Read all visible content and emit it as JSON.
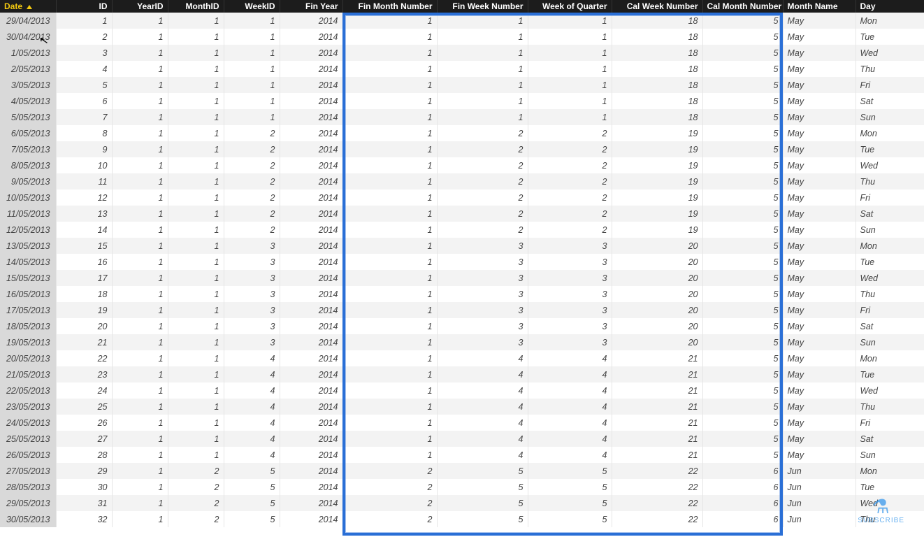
{
  "columns": [
    {
      "key": "date",
      "label": "Date",
      "align": "left",
      "sort": true,
      "colclass": "c-date"
    },
    {
      "key": "id",
      "label": "ID",
      "align": "right",
      "colclass": "c-id"
    },
    {
      "key": "year_id",
      "label": "YearID",
      "align": "right",
      "colclass": "c-yearid"
    },
    {
      "key": "month_id",
      "label": "MonthID",
      "align": "right",
      "colclass": "c-monthid"
    },
    {
      "key": "week_id",
      "label": "WeekID",
      "align": "right",
      "colclass": "c-weekid"
    },
    {
      "key": "fin_year",
      "label": "Fin Year",
      "align": "right",
      "colclass": "c-finyr"
    },
    {
      "key": "fin_month_number",
      "label": "Fin Month Number",
      "align": "right",
      "colclass": "c-finmon"
    },
    {
      "key": "fin_week_number",
      "label": "Fin Week Number",
      "align": "right",
      "colclass": "c-finwk"
    },
    {
      "key": "week_of_quarter",
      "label": "Week of Quarter",
      "align": "right",
      "colclass": "c-woq"
    },
    {
      "key": "cal_week_number",
      "label": "Cal Week Number",
      "align": "right",
      "colclass": "c-calwk"
    },
    {
      "key": "cal_month_number",
      "label": "Cal Month Number",
      "align": "right",
      "colclass": "c-calmon"
    },
    {
      "key": "month_name",
      "label": "Month Name",
      "align": "left",
      "colclass": "c-mname"
    },
    {
      "key": "day",
      "label": "Day",
      "align": "left",
      "colclass": "c-day"
    }
  ],
  "rows": [
    {
      "date": "29/04/2013",
      "id": "1",
      "year_id": "1",
      "month_id": "1",
      "week_id": "1",
      "fin_year": "2014",
      "fin_month_number": "1",
      "fin_week_number": "1",
      "week_of_quarter": "1",
      "cal_week_number": "18",
      "cal_month_number": "5",
      "month_name": "May",
      "day": "Mon"
    },
    {
      "date": "30/04/2013",
      "id": "2",
      "year_id": "1",
      "month_id": "1",
      "week_id": "1",
      "fin_year": "2014",
      "fin_month_number": "1",
      "fin_week_number": "1",
      "week_of_quarter": "1",
      "cal_week_number": "18",
      "cal_month_number": "5",
      "month_name": "May",
      "day": "Tue"
    },
    {
      "date": "1/05/2013",
      "id": "3",
      "year_id": "1",
      "month_id": "1",
      "week_id": "1",
      "fin_year": "2014",
      "fin_month_number": "1",
      "fin_week_number": "1",
      "week_of_quarter": "1",
      "cal_week_number": "18",
      "cal_month_number": "5",
      "month_name": "May",
      "day": "Wed"
    },
    {
      "date": "2/05/2013",
      "id": "4",
      "year_id": "1",
      "month_id": "1",
      "week_id": "1",
      "fin_year": "2014",
      "fin_month_number": "1",
      "fin_week_number": "1",
      "week_of_quarter": "1",
      "cal_week_number": "18",
      "cal_month_number": "5",
      "month_name": "May",
      "day": "Thu"
    },
    {
      "date": "3/05/2013",
      "id": "5",
      "year_id": "1",
      "month_id": "1",
      "week_id": "1",
      "fin_year": "2014",
      "fin_month_number": "1",
      "fin_week_number": "1",
      "week_of_quarter": "1",
      "cal_week_number": "18",
      "cal_month_number": "5",
      "month_name": "May",
      "day": "Fri"
    },
    {
      "date": "4/05/2013",
      "id": "6",
      "year_id": "1",
      "month_id": "1",
      "week_id": "1",
      "fin_year": "2014",
      "fin_month_number": "1",
      "fin_week_number": "1",
      "week_of_quarter": "1",
      "cal_week_number": "18",
      "cal_month_number": "5",
      "month_name": "May",
      "day": "Sat"
    },
    {
      "date": "5/05/2013",
      "id": "7",
      "year_id": "1",
      "month_id": "1",
      "week_id": "1",
      "fin_year": "2014",
      "fin_month_number": "1",
      "fin_week_number": "1",
      "week_of_quarter": "1",
      "cal_week_number": "18",
      "cal_month_number": "5",
      "month_name": "May",
      "day": "Sun"
    },
    {
      "date": "6/05/2013",
      "id": "8",
      "year_id": "1",
      "month_id": "1",
      "week_id": "2",
      "fin_year": "2014",
      "fin_month_number": "1",
      "fin_week_number": "2",
      "week_of_quarter": "2",
      "cal_week_number": "19",
      "cal_month_number": "5",
      "month_name": "May",
      "day": "Mon"
    },
    {
      "date": "7/05/2013",
      "id": "9",
      "year_id": "1",
      "month_id": "1",
      "week_id": "2",
      "fin_year": "2014",
      "fin_month_number": "1",
      "fin_week_number": "2",
      "week_of_quarter": "2",
      "cal_week_number": "19",
      "cal_month_number": "5",
      "month_name": "May",
      "day": "Tue"
    },
    {
      "date": "8/05/2013",
      "id": "10",
      "year_id": "1",
      "month_id": "1",
      "week_id": "2",
      "fin_year": "2014",
      "fin_month_number": "1",
      "fin_week_number": "2",
      "week_of_quarter": "2",
      "cal_week_number": "19",
      "cal_month_number": "5",
      "month_name": "May",
      "day": "Wed"
    },
    {
      "date": "9/05/2013",
      "id": "11",
      "year_id": "1",
      "month_id": "1",
      "week_id": "2",
      "fin_year": "2014",
      "fin_month_number": "1",
      "fin_week_number": "2",
      "week_of_quarter": "2",
      "cal_week_number": "19",
      "cal_month_number": "5",
      "month_name": "May",
      "day": "Thu"
    },
    {
      "date": "10/05/2013",
      "id": "12",
      "year_id": "1",
      "month_id": "1",
      "week_id": "2",
      "fin_year": "2014",
      "fin_month_number": "1",
      "fin_week_number": "2",
      "week_of_quarter": "2",
      "cal_week_number": "19",
      "cal_month_number": "5",
      "month_name": "May",
      "day": "Fri"
    },
    {
      "date": "11/05/2013",
      "id": "13",
      "year_id": "1",
      "month_id": "1",
      "week_id": "2",
      "fin_year": "2014",
      "fin_month_number": "1",
      "fin_week_number": "2",
      "week_of_quarter": "2",
      "cal_week_number": "19",
      "cal_month_number": "5",
      "month_name": "May",
      "day": "Sat"
    },
    {
      "date": "12/05/2013",
      "id": "14",
      "year_id": "1",
      "month_id": "1",
      "week_id": "2",
      "fin_year": "2014",
      "fin_month_number": "1",
      "fin_week_number": "2",
      "week_of_quarter": "2",
      "cal_week_number": "19",
      "cal_month_number": "5",
      "month_name": "May",
      "day": "Sun"
    },
    {
      "date": "13/05/2013",
      "id": "15",
      "year_id": "1",
      "month_id": "1",
      "week_id": "3",
      "fin_year": "2014",
      "fin_month_number": "1",
      "fin_week_number": "3",
      "week_of_quarter": "3",
      "cal_week_number": "20",
      "cal_month_number": "5",
      "month_name": "May",
      "day": "Mon"
    },
    {
      "date": "14/05/2013",
      "id": "16",
      "year_id": "1",
      "month_id": "1",
      "week_id": "3",
      "fin_year": "2014",
      "fin_month_number": "1",
      "fin_week_number": "3",
      "week_of_quarter": "3",
      "cal_week_number": "20",
      "cal_month_number": "5",
      "month_name": "May",
      "day": "Tue"
    },
    {
      "date": "15/05/2013",
      "id": "17",
      "year_id": "1",
      "month_id": "1",
      "week_id": "3",
      "fin_year": "2014",
      "fin_month_number": "1",
      "fin_week_number": "3",
      "week_of_quarter": "3",
      "cal_week_number": "20",
      "cal_month_number": "5",
      "month_name": "May",
      "day": "Wed"
    },
    {
      "date": "16/05/2013",
      "id": "18",
      "year_id": "1",
      "month_id": "1",
      "week_id": "3",
      "fin_year": "2014",
      "fin_month_number": "1",
      "fin_week_number": "3",
      "week_of_quarter": "3",
      "cal_week_number": "20",
      "cal_month_number": "5",
      "month_name": "May",
      "day": "Thu"
    },
    {
      "date": "17/05/2013",
      "id": "19",
      "year_id": "1",
      "month_id": "1",
      "week_id": "3",
      "fin_year": "2014",
      "fin_month_number": "1",
      "fin_week_number": "3",
      "week_of_quarter": "3",
      "cal_week_number": "20",
      "cal_month_number": "5",
      "month_name": "May",
      "day": "Fri"
    },
    {
      "date": "18/05/2013",
      "id": "20",
      "year_id": "1",
      "month_id": "1",
      "week_id": "3",
      "fin_year": "2014",
      "fin_month_number": "1",
      "fin_week_number": "3",
      "week_of_quarter": "3",
      "cal_week_number": "20",
      "cal_month_number": "5",
      "month_name": "May",
      "day": "Sat"
    },
    {
      "date": "19/05/2013",
      "id": "21",
      "year_id": "1",
      "month_id": "1",
      "week_id": "3",
      "fin_year": "2014",
      "fin_month_number": "1",
      "fin_week_number": "3",
      "week_of_quarter": "3",
      "cal_week_number": "20",
      "cal_month_number": "5",
      "month_name": "May",
      "day": "Sun"
    },
    {
      "date": "20/05/2013",
      "id": "22",
      "year_id": "1",
      "month_id": "1",
      "week_id": "4",
      "fin_year": "2014",
      "fin_month_number": "1",
      "fin_week_number": "4",
      "week_of_quarter": "4",
      "cal_week_number": "21",
      "cal_month_number": "5",
      "month_name": "May",
      "day": "Mon"
    },
    {
      "date": "21/05/2013",
      "id": "23",
      "year_id": "1",
      "month_id": "1",
      "week_id": "4",
      "fin_year": "2014",
      "fin_month_number": "1",
      "fin_week_number": "4",
      "week_of_quarter": "4",
      "cal_week_number": "21",
      "cal_month_number": "5",
      "month_name": "May",
      "day": "Tue"
    },
    {
      "date": "22/05/2013",
      "id": "24",
      "year_id": "1",
      "month_id": "1",
      "week_id": "4",
      "fin_year": "2014",
      "fin_month_number": "1",
      "fin_week_number": "4",
      "week_of_quarter": "4",
      "cal_week_number": "21",
      "cal_month_number": "5",
      "month_name": "May",
      "day": "Wed"
    },
    {
      "date": "23/05/2013",
      "id": "25",
      "year_id": "1",
      "month_id": "1",
      "week_id": "4",
      "fin_year": "2014",
      "fin_month_number": "1",
      "fin_week_number": "4",
      "week_of_quarter": "4",
      "cal_week_number": "21",
      "cal_month_number": "5",
      "month_name": "May",
      "day": "Thu"
    },
    {
      "date": "24/05/2013",
      "id": "26",
      "year_id": "1",
      "month_id": "1",
      "week_id": "4",
      "fin_year": "2014",
      "fin_month_number": "1",
      "fin_week_number": "4",
      "week_of_quarter": "4",
      "cal_week_number": "21",
      "cal_month_number": "5",
      "month_name": "May",
      "day": "Fri"
    },
    {
      "date": "25/05/2013",
      "id": "27",
      "year_id": "1",
      "month_id": "1",
      "week_id": "4",
      "fin_year": "2014",
      "fin_month_number": "1",
      "fin_week_number": "4",
      "week_of_quarter": "4",
      "cal_week_number": "21",
      "cal_month_number": "5",
      "month_name": "May",
      "day": "Sat"
    },
    {
      "date": "26/05/2013",
      "id": "28",
      "year_id": "1",
      "month_id": "1",
      "week_id": "4",
      "fin_year": "2014",
      "fin_month_number": "1",
      "fin_week_number": "4",
      "week_of_quarter": "4",
      "cal_week_number": "21",
      "cal_month_number": "5",
      "month_name": "May",
      "day": "Sun"
    },
    {
      "date": "27/05/2013",
      "id": "29",
      "year_id": "1",
      "month_id": "2",
      "week_id": "5",
      "fin_year": "2014",
      "fin_month_number": "2",
      "fin_week_number": "5",
      "week_of_quarter": "5",
      "cal_week_number": "22",
      "cal_month_number": "6",
      "month_name": "Jun",
      "day": "Mon"
    },
    {
      "date": "28/05/2013",
      "id": "30",
      "year_id": "1",
      "month_id": "2",
      "week_id": "5",
      "fin_year": "2014",
      "fin_month_number": "2",
      "fin_week_number": "5",
      "week_of_quarter": "5",
      "cal_week_number": "22",
      "cal_month_number": "6",
      "month_name": "Jun",
      "day": "Tue"
    },
    {
      "date": "29/05/2013",
      "id": "31",
      "year_id": "1",
      "month_id": "2",
      "week_id": "5",
      "fin_year": "2014",
      "fin_month_number": "2",
      "fin_week_number": "5",
      "week_of_quarter": "5",
      "cal_week_number": "22",
      "cal_month_number": "6",
      "month_name": "Jun",
      "day": "Wed"
    },
    {
      "date": "30/05/2013",
      "id": "32",
      "year_id": "1",
      "month_id": "2",
      "week_id": "5",
      "fin_year": "2014",
      "fin_month_number": "2",
      "fin_week_number": "5",
      "week_of_quarter": "5",
      "cal_week_number": "22",
      "cal_month_number": "6",
      "month_name": "Jun",
      "day": "Thu"
    }
  ],
  "watermark": {
    "label": "SUBSCRIBE",
    "icon": "dna-icon"
  },
  "colors": {
    "selection": "#2a6fd6",
    "header_bg": "#1c1c1c",
    "sort_accent": "#f3c910"
  }
}
